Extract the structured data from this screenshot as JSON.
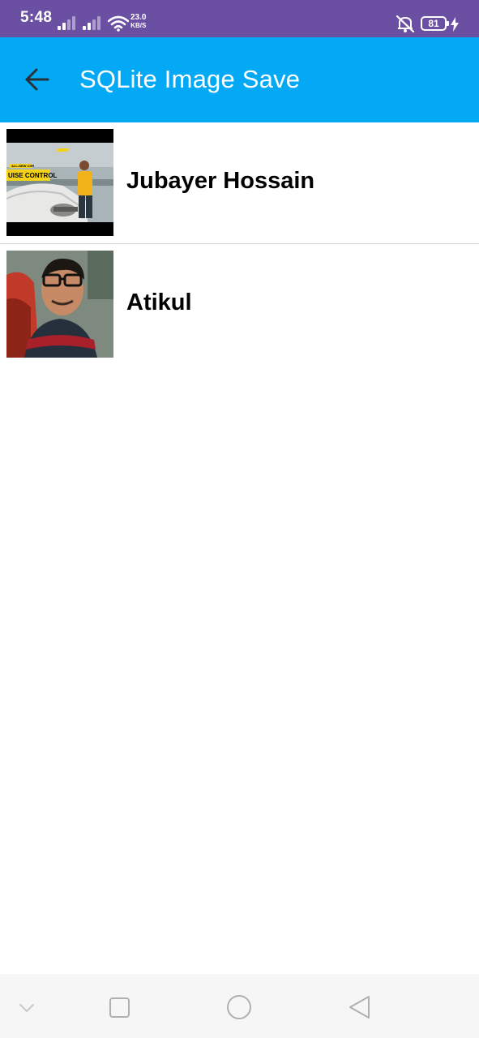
{
  "status_bar": {
    "time": "5:48",
    "net_speed_value": "23.0",
    "net_speed_unit": "KB/S",
    "battery_level": "81",
    "icons": [
      "signal-icon",
      "signal-icon",
      "wifi-icon",
      "mute-icon",
      "battery-icon",
      "charging-icon"
    ],
    "background": "#6a4fa3"
  },
  "app_bar": {
    "title": "SQLite Image Save",
    "back_icon": "arrow-left-icon",
    "background": "#03a9f4"
  },
  "list": {
    "items": [
      {
        "name": "Jubayer Hossain",
        "thumbnail": "photo-man-with-car"
      },
      {
        "name": "Atikul",
        "thumbnail": "photo-selfie-man-glasses"
      }
    ]
  },
  "nav_bar": {
    "icons": [
      "chevron-down-icon",
      "recents-square-icon",
      "home-circle-icon",
      "back-triangle-icon"
    ]
  }
}
